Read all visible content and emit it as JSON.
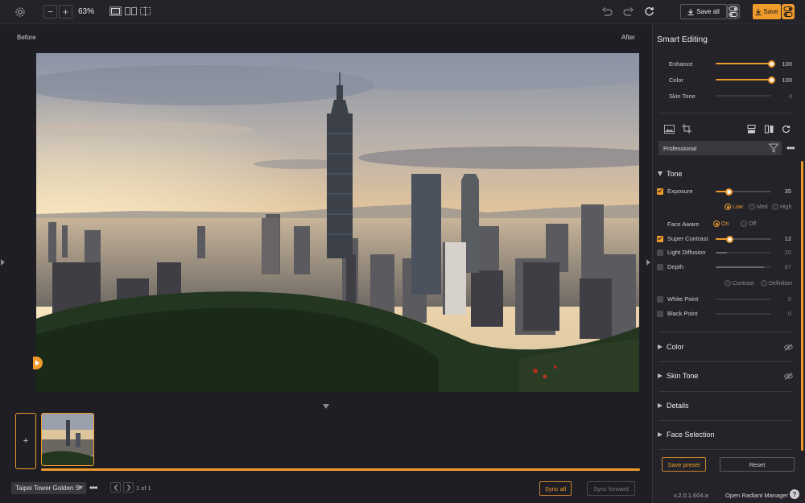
{
  "toolbar": {
    "zoom_out": "−",
    "zoom_in": "+",
    "zoom_level": "63%",
    "save_all_label": "Save all",
    "save_label": "Save"
  },
  "canvas": {
    "before_label": "Before",
    "after_label": "After"
  },
  "filmstrip": {
    "add_label": "+"
  },
  "bottombar": {
    "preset_name": "Taipei Tower Golden S",
    "more": "•••",
    "page_info": "1 of 1",
    "sync_all": "Sync all",
    "sync_forward": "Sync forward"
  },
  "panel": {
    "title": "Smart Editing",
    "smart_sliders": [
      {
        "label": "Enhance",
        "value": "100",
        "fraction": 1.0,
        "active": true
      },
      {
        "label": "Color",
        "value": "100",
        "fraction": 1.0,
        "active": true
      },
      {
        "label": "Skin Tone",
        "value": "0",
        "fraction": 0.0,
        "active": false
      }
    ],
    "preset_dropdown": "Professional",
    "preset_more": "•••",
    "tone": {
      "title": "Tone",
      "exposure_label": "Exposure",
      "exposure_value": "35",
      "exposure_fraction": 0.23,
      "levels": [
        "Low",
        "Med",
        "High"
      ],
      "face_aware_label": "Face Aware",
      "face_aware_on": "On",
      "face_aware_off": "Off",
      "super_contrast_label": "Super Contrast",
      "super_contrast_value": "12",
      "super_contrast_fraction": 0.24,
      "light_diffusion_label": "Light Diffusion",
      "light_diffusion_value": "20",
      "light_diffusion_fraction": 0.2,
      "depth_label": "Depth",
      "depth_value": "87",
      "depth_fraction": 0.87,
      "depth_modes": [
        "Contrast",
        "Definition"
      ],
      "white_point_label": "White Point",
      "white_point_value": "0",
      "black_point_label": "Black Point",
      "black_point_value": "0"
    },
    "sections": [
      "Color",
      "Skin Tone",
      "Details",
      "Face Selection"
    ],
    "save_preset": "Save preset",
    "reset": "Reset",
    "version": "v.2.0.1.604.a",
    "open_manager": "Open Radiant Manager",
    "help": "?"
  },
  "colors": {
    "accent": "#ef9b2c",
    "background": "#1f1e24",
    "panel": "#242329"
  }
}
